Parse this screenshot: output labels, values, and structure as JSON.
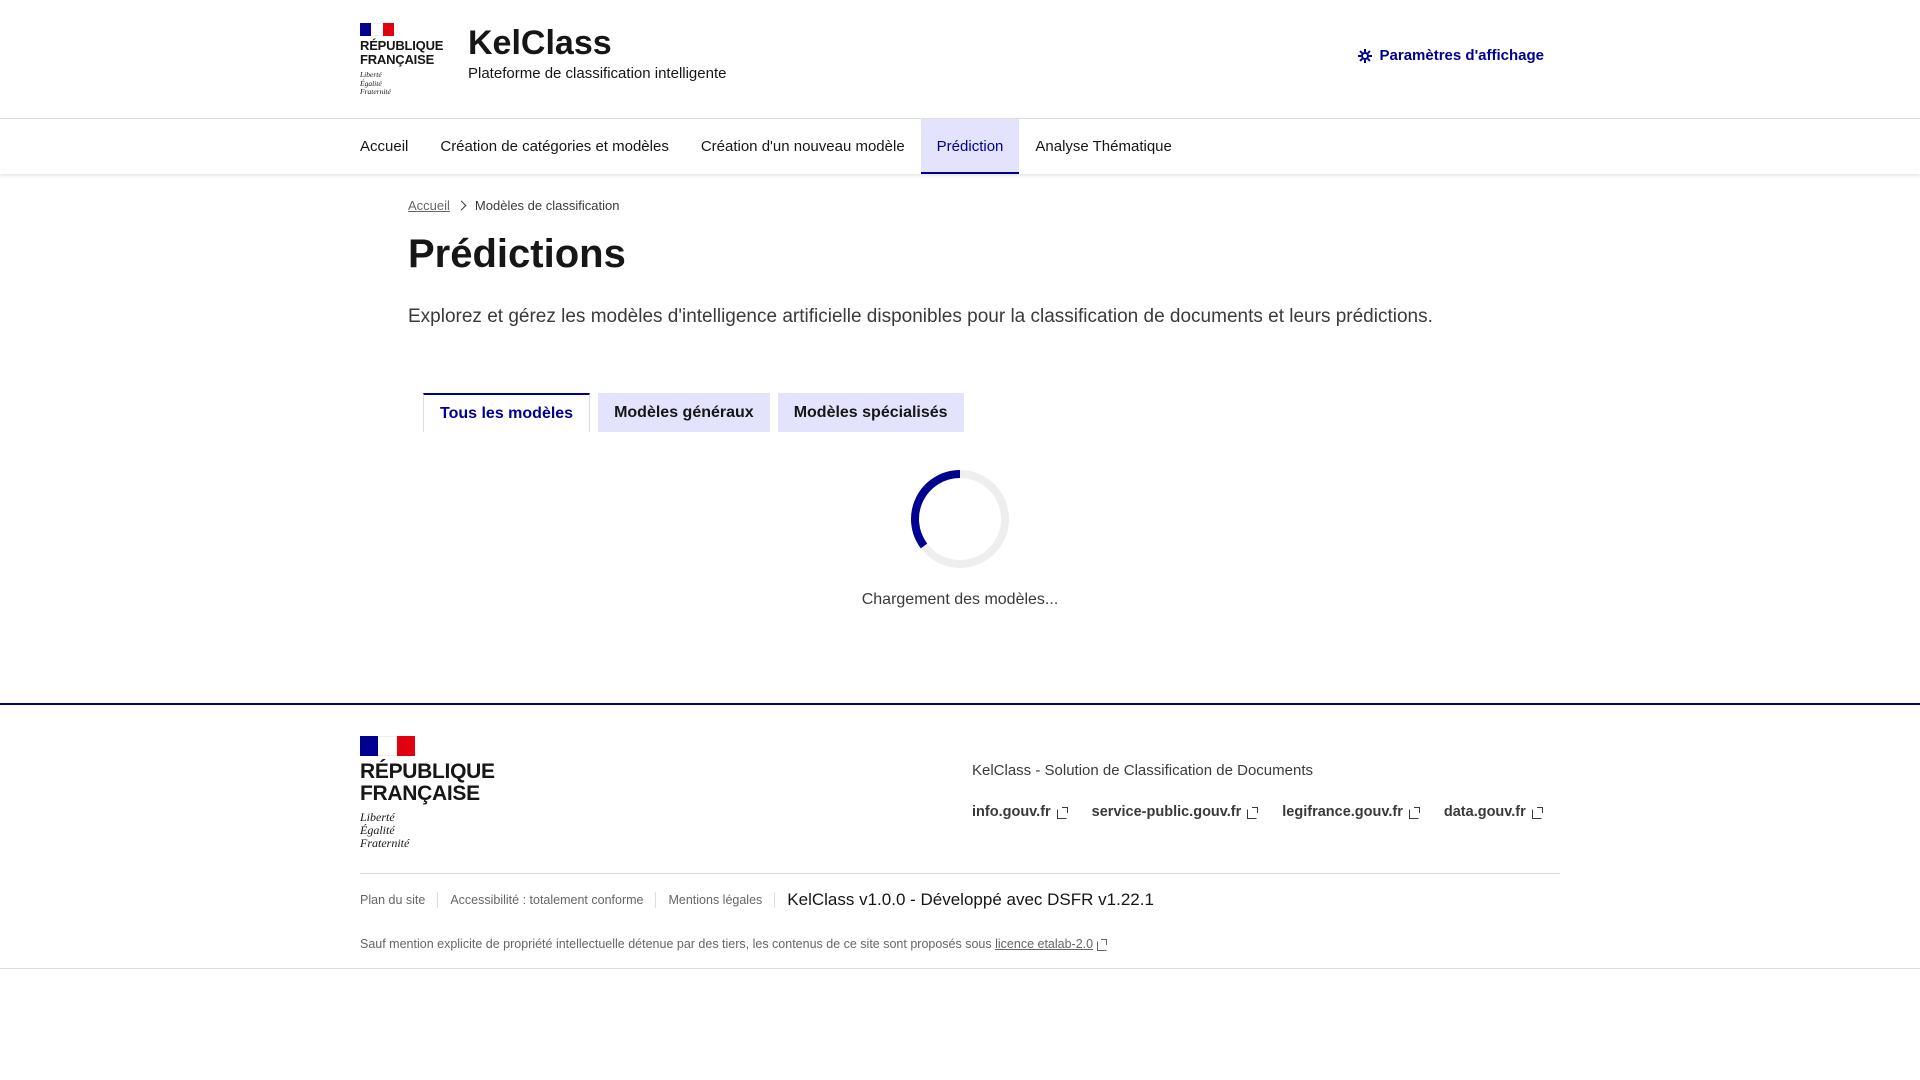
{
  "header": {
    "logo": {
      "line1": "RÉPUBLIQUE",
      "line2": "FRANÇAISE",
      "motto": [
        "Liberté",
        "Égalité",
        "Fraternité"
      ]
    },
    "title": "KelClass",
    "subtitle": "Plateforme de classification intelligente",
    "settings_label": "Paramètres d'affichage",
    "settings_icon": "sun-icon"
  },
  "nav": {
    "items": [
      {
        "label": "Accueil"
      },
      {
        "label": "Création de catégories et modèles"
      },
      {
        "label": "Création d'un nouveau modèle"
      },
      {
        "label": "Prédiction",
        "active": true
      },
      {
        "label": "Analyse Thématique"
      }
    ]
  },
  "breadcrumb": {
    "home": "Accueil",
    "current": "Modèles de classification"
  },
  "page": {
    "title": "Prédictions",
    "lead": "Explorez et gérez les modèles d'intelligence artificielle disponibles pour la classification de documents et leurs prédictions."
  },
  "tabs": [
    {
      "label": "Tous les modèles",
      "active": true
    },
    {
      "label": "Modèles généraux"
    },
    {
      "label": "Modèles spécialisés"
    }
  ],
  "loading": {
    "text": "Chargement des modèles..."
  },
  "footer": {
    "logo": {
      "line1": "RÉPUBLIQUE",
      "line2": "FRANÇAISE",
      "motto": [
        "Liberté",
        "Égalité",
        "Fraternité"
      ]
    },
    "description": "KelClass - Solution de Classification de Documents",
    "links": [
      "info.gouv.fr",
      "service-public.gouv.fr",
      "legifrance.gouv.fr",
      "data.gouv.fr"
    ],
    "bottom_links": [
      "Plan du site",
      "Accessibilité : totalement conforme",
      "Mentions légales"
    ],
    "version": "KelClass v1.0.0 - Développé avec DSFR v1.22.1",
    "license_text": "Sauf mention explicite de propriété intellectuelle détenue par des tiers, les contenus de ce site sont proposés sous ",
    "license_link": "licence etalab-2.0"
  },
  "colors": {
    "primary": "#000091",
    "accent_red": "#e1000f",
    "tab_bg": "#e3e3fd",
    "text": "#161616",
    "muted": "#666666"
  }
}
